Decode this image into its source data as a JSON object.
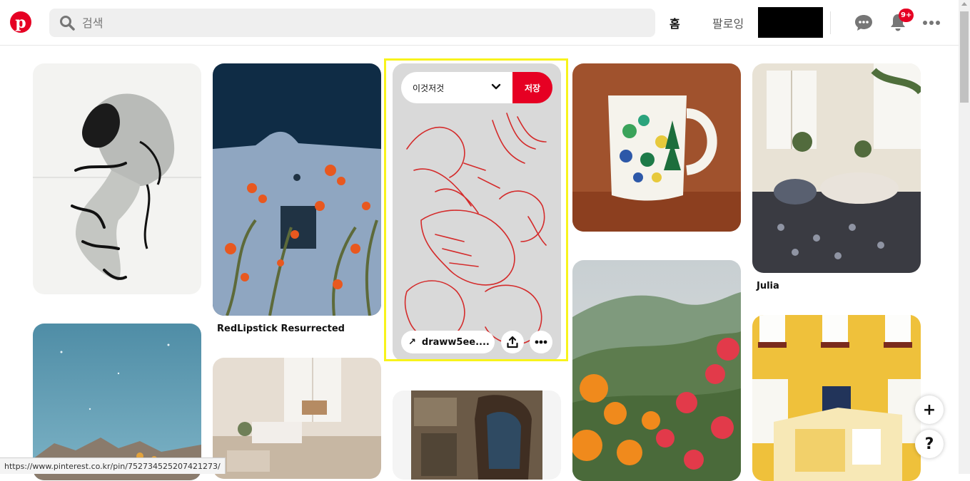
{
  "header": {
    "logo_letter": "p",
    "search_placeholder": "검색",
    "nav_home": "홈",
    "nav_following": "팔로잉",
    "notification_badge": "9+"
  },
  "pins": {
    "col2_first_title": "RedLipstick Resurrected",
    "col5_first_title": "Julia"
  },
  "selected_pin": {
    "board_name": "이것저것",
    "save_label": "저장",
    "link_text": "draww5ee....",
    "link_arrow": "↗"
  },
  "floating": {
    "add_label": "+",
    "help_label": "?"
  },
  "statusbar": {
    "url": "https://www.pinterest.co.kr/pin/752734525207421273/"
  },
  "colors": {
    "brand": "#e60023",
    "highlight": "#f8f31c"
  }
}
